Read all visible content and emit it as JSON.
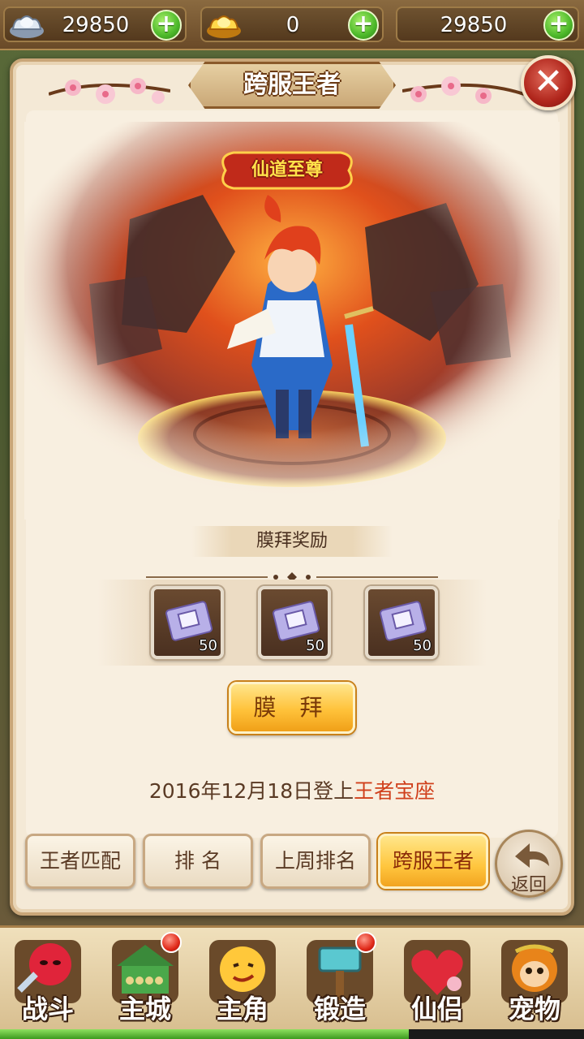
{
  "currencies": [
    {
      "icon": "silver-ingot-icon",
      "value": "29850"
    },
    {
      "icon": "gold-ingot-icon",
      "value": "0"
    },
    {
      "icon": "",
      "value": "29850"
    }
  ],
  "dialog": {
    "title": "跨服王者",
    "hero_title": "仙道至尊",
    "reward_header": "膜拜奖励",
    "rewards": [
      {
        "icon": "scroll-voucher-icon",
        "qty": "50"
      },
      {
        "icon": "scroll-voucher-icon",
        "qty": "50"
      },
      {
        "icon": "scroll-voucher-icon",
        "qty": "50"
      }
    ],
    "worship_label": "膜 拜",
    "date_prefix": "2016年12月18日登上",
    "date_highlight": "王者宝座"
  },
  "tabs": [
    {
      "label": "王者匹配",
      "active": false
    },
    {
      "label": "排 名",
      "active": false
    },
    {
      "label": "上周排名",
      "active": false
    },
    {
      "label": "跨服王者",
      "active": true
    }
  ],
  "back_label": "返回",
  "nav": [
    {
      "label": "战斗",
      "icon": "battle-icon",
      "badge": false
    },
    {
      "label": "主城",
      "icon": "city-icon",
      "badge": true
    },
    {
      "label": "主角",
      "icon": "hero-icon",
      "badge": false
    },
    {
      "label": "锻造",
      "icon": "forge-hammer-icon",
      "badge": true
    },
    {
      "label": "仙侣",
      "icon": "partner-heart-icon",
      "badge": false
    },
    {
      "label": "宠物",
      "icon": "pet-monkey-icon",
      "badge": false
    }
  ],
  "colors": {
    "accent_gold": "#ffc23a",
    "highlight_red": "#d0401c",
    "panel_bg": "#f4e9d6"
  }
}
